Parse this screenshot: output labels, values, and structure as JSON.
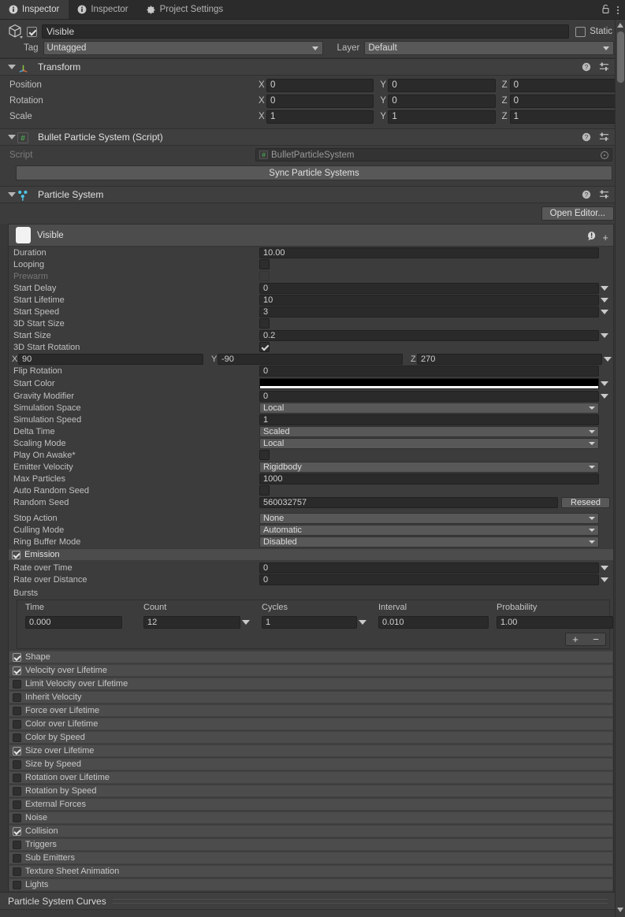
{
  "tabs": [
    {
      "label": "Inspector",
      "icon": "info-icon",
      "active": true
    },
    {
      "label": "Inspector",
      "icon": "info-icon",
      "active": false
    },
    {
      "label": "Project Settings",
      "icon": "gear-icon",
      "active": false
    }
  ],
  "window_controls": {
    "lock": "lock-icon",
    "menu": "kebab-menu-icon"
  },
  "gameobject": {
    "enabled_checkbox": true,
    "name": "Visible",
    "static_label": "Static",
    "static_checked": false,
    "tag_label": "Tag",
    "tag_value": "Untagged",
    "layer_label": "Layer",
    "layer_value": "Default"
  },
  "transform": {
    "title": "Transform",
    "rows": [
      {
        "label": "Position",
        "x": "0",
        "y": "0",
        "z": "0"
      },
      {
        "label": "Rotation",
        "x": "0",
        "y": "0",
        "z": "0"
      },
      {
        "label": "Scale",
        "x": "1",
        "y": "1",
        "z": "1"
      }
    ],
    "axes": [
      "X",
      "Y",
      "Z"
    ]
  },
  "script_component": {
    "title": "Bullet Particle System (Script)",
    "script_label": "Script",
    "script_value": "BulletParticleSystem",
    "sync_button": "Sync Particle Systems"
  },
  "particle_system": {
    "title": "Particle System",
    "open_editor": "Open Editor...",
    "main_module_name": "Visible",
    "properties": [
      {
        "label": "Duration",
        "type": "input",
        "value": "10.00",
        "dropdown": false
      },
      {
        "label": "Looping",
        "type": "checkbox",
        "value": false
      },
      {
        "label": "Prewarm",
        "type": "checkbox",
        "value": false,
        "dim": true
      },
      {
        "label": "Start Delay",
        "type": "input",
        "value": "0",
        "dropdown": true
      },
      {
        "label": "Start Lifetime",
        "type": "input",
        "value": "10",
        "dropdown": true
      },
      {
        "label": "Start Speed",
        "type": "input",
        "value": "3",
        "dropdown": true
      },
      {
        "label": "3D Start Size",
        "type": "checkbox",
        "value": false
      },
      {
        "label": "Start Size",
        "type": "input",
        "value": "0.2",
        "dropdown": true
      },
      {
        "label": "3D Start Rotation",
        "type": "checkbox",
        "value": true
      }
    ],
    "rotation_vector": {
      "x_label": "X",
      "x": "90",
      "y_label": "Y",
      "y": "-90",
      "z_label": "Z",
      "z": "270",
      "dropdown": true
    },
    "properties2": [
      {
        "label": "Flip Rotation",
        "type": "input",
        "value": "0",
        "dropdown": false
      },
      {
        "label": "Start Color",
        "type": "color",
        "value": "#000000",
        "dropdown": true
      },
      {
        "label": "Gravity Modifier",
        "type": "input",
        "value": "0",
        "dropdown": true
      },
      {
        "label": "Simulation Space",
        "type": "popup",
        "value": "Local"
      },
      {
        "label": "Simulation Speed",
        "type": "input",
        "value": "1",
        "dropdown": false
      },
      {
        "label": "Delta Time",
        "type": "popup",
        "value": "Scaled"
      },
      {
        "label": "Scaling Mode",
        "type": "popup",
        "value": "Local"
      },
      {
        "label": "Play On Awake*",
        "type": "checkbox",
        "value": false
      },
      {
        "label": "Emitter Velocity",
        "type": "popup",
        "value": "Rigidbody"
      },
      {
        "label": "Max Particles",
        "type": "input",
        "value": "1000",
        "dropdown": false
      },
      {
        "label": "Auto Random Seed",
        "type": "checkbox",
        "value": false
      }
    ],
    "random_seed": {
      "label": "Random Seed",
      "value": "560032757",
      "button": "Reseed"
    },
    "properties3": [
      {
        "label": "Stop Action",
        "type": "popup",
        "value": "None"
      },
      {
        "label": "Culling Mode",
        "type": "popup",
        "value": "Automatic"
      },
      {
        "label": "Ring Buffer Mode",
        "type": "popup",
        "value": "Disabled"
      }
    ],
    "emission": {
      "title": "Emission",
      "enabled": true,
      "rate_over_time": {
        "label": "Rate over Time",
        "value": "0"
      },
      "rate_over_distance": {
        "label": "Rate over Distance",
        "value": "0"
      },
      "bursts_label": "Bursts",
      "burst_columns": [
        "Time",
        "Count",
        "Cycles",
        "Interval",
        "Probability"
      ],
      "burst_rows": [
        {
          "time": "0.000",
          "count": "12",
          "cycles": "1",
          "interval": "0.010",
          "probability": "1.00"
        }
      ],
      "add_button": "+",
      "remove_button": "−"
    },
    "modules": [
      {
        "label": "Shape",
        "enabled": true
      },
      {
        "label": "Velocity over Lifetime",
        "enabled": true
      },
      {
        "label": "Limit Velocity over Lifetime",
        "enabled": false
      },
      {
        "label": "Inherit Velocity",
        "enabled": false
      },
      {
        "label": "Force over Lifetime",
        "enabled": false
      },
      {
        "label": "Color over Lifetime",
        "enabled": false
      },
      {
        "label": "Color by Speed",
        "enabled": false
      },
      {
        "label": "Size over Lifetime",
        "enabled": true
      },
      {
        "label": "Size by Speed",
        "enabled": false
      },
      {
        "label": "Rotation over Lifetime",
        "enabled": false
      },
      {
        "label": "Rotation by Speed",
        "enabled": false
      },
      {
        "label": "External Forces",
        "enabled": false
      },
      {
        "label": "Noise",
        "enabled": false
      },
      {
        "label": "Collision",
        "enabled": true
      },
      {
        "label": "Triggers",
        "enabled": false
      },
      {
        "label": "Sub Emitters",
        "enabled": false
      },
      {
        "label": "Texture Sheet Animation",
        "enabled": false
      },
      {
        "label": "Lights",
        "enabled": false
      }
    ]
  },
  "bottom": {
    "curves_label": "Particle System Curves",
    "menu_icon": "kebab-menu-icon"
  },
  "colors": {
    "window_bg": "#383838",
    "panel_bg": "#3c3c3c",
    "header_bg": "#3f3f3f",
    "field_bg": "#2a2a2a",
    "popup_bg": "#585858",
    "module_bg": "#4c4c4c",
    "text": "#c4c4c4",
    "accent_script_icon": "#4caf50",
    "accent_ps_icon": "#4fc3e8"
  }
}
